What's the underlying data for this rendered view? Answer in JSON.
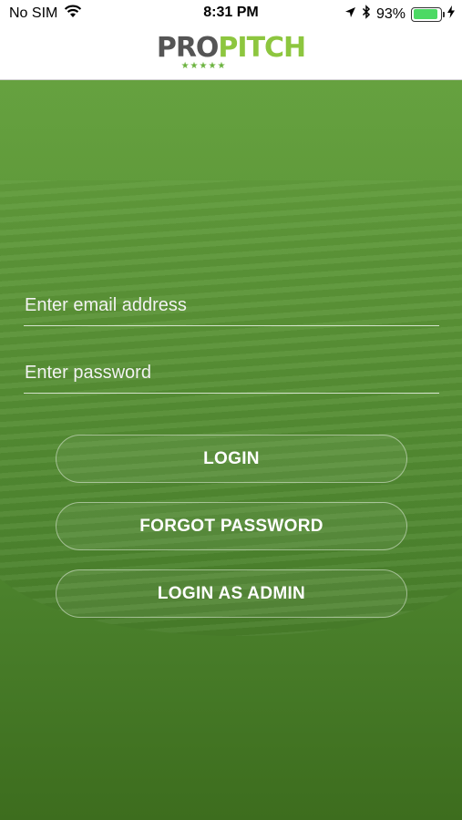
{
  "status_bar": {
    "carrier": "No SIM",
    "time": "8:31 PM",
    "battery": "93%",
    "battery_level": 0.93,
    "icons": [
      "wifi-icon",
      "location-arrow-icon",
      "bluetooth-icon",
      "battery-icon",
      "charging-bolt-icon"
    ]
  },
  "header": {
    "logo_part1": "PRO",
    "logo_part2": "PITCH",
    "logo_stars": "★★★★★"
  },
  "login": {
    "email_placeholder": "Enter email address",
    "password_placeholder": "Enter password",
    "login_label": "LOGIN",
    "forgot_label": "FORGOT PASSWORD",
    "admin_label": "LOGIN AS ADMIN"
  },
  "colors": {
    "brand_green": "#8dc63f",
    "background_green": "#5b9437",
    "battery_green": "#4cd964"
  }
}
